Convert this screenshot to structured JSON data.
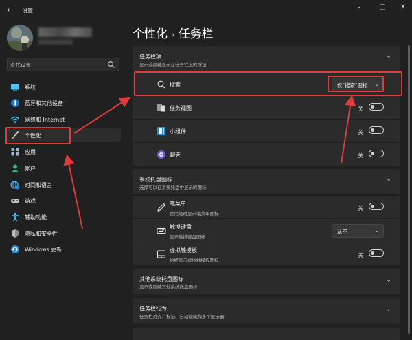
{
  "window": {
    "title": "设置",
    "back_icon": "back-arrow-icon",
    "controls": [
      "minimize-icon",
      "maximize-icon",
      "close-icon"
    ]
  },
  "sidebar": {
    "search": {
      "placeholder": "查找设置",
      "value": ""
    },
    "items": [
      {
        "label": "系统",
        "icon": "monitor-icon",
        "color": "#4cc2ff"
      },
      {
        "label": "蓝牙和其他设备",
        "icon": "bluetooth-icon",
        "color": "#4cc2ff"
      },
      {
        "label": "网络和 Internet",
        "icon": "wifi-icon",
        "color": "#4cc2ff"
      },
      {
        "label": "个性化",
        "icon": "brush-icon",
        "color": "#e8a96a",
        "active": true
      },
      {
        "label": "应用",
        "icon": "apps-icon",
        "color": "#9fb7c8"
      },
      {
        "label": "帐户",
        "icon": "person-icon",
        "color": "#3fb27f"
      },
      {
        "label": "时间和语言",
        "icon": "globe-clock-icon",
        "color": "#4cc2ff"
      },
      {
        "label": "游戏",
        "icon": "gamepad-icon",
        "color": "#bfbfbf"
      },
      {
        "label": "辅助功能",
        "icon": "accessibility-icon",
        "color": "#4cc2ff"
      },
      {
        "label": "隐私和安全性",
        "icon": "shield-icon",
        "color": "#9a9a9a"
      },
      {
        "label": "Windows 更新",
        "icon": "update-icon",
        "color": "#4cc2ff"
      }
    ]
  },
  "breadcrumb": {
    "parent": "个性化",
    "separator": "›",
    "current": "任务栏"
  },
  "sections": {
    "taskbar_items": {
      "title": "任务栏项",
      "subtitle": "显示或隐藏显示在任务栏上的按钮",
      "rows": [
        {
          "label": "搜索",
          "icon": "search-icon",
          "control": "dropdown",
          "value": "仅\"搜索\"图标"
        },
        {
          "label": "任务视图",
          "icon": "task-view-icon",
          "control": "toggle",
          "state": "关"
        },
        {
          "label": "小组件",
          "icon": "widgets-icon",
          "control": "toggle",
          "state": "关"
        },
        {
          "label": "聊天",
          "icon": "chat-icon",
          "control": "toggle",
          "state": "关"
        }
      ]
    },
    "tray_icons": {
      "title": "系统托盘图标",
      "subtitle": "选择可以在系统托盘中显示的图标",
      "rows": [
        {
          "label": "笔菜单",
          "sub": "使用笔时显示笔菜单图标",
          "icon": "pen-icon",
          "control": "toggle",
          "state": "关"
        },
        {
          "label": "触摸键盘",
          "sub": "显示触摸键盘图标",
          "icon": "keyboard-icon",
          "control": "dropdown",
          "value": "从不"
        },
        {
          "label": "虚拟触摸板",
          "sub": "始终显示虚拟触摸板图标",
          "icon": "touchpad-icon",
          "control": "toggle",
          "state": "关"
        }
      ]
    },
    "other_tray": {
      "title": "其他系统托盘图标",
      "subtitle": "显示或隐藏其他系统托盘图标"
    },
    "behaviors": {
      "title": "任务栏行为",
      "subtitle": "任务栏对齐、标记、自动隐藏和多个显示器"
    }
  },
  "colors": {
    "annotation_red": "#e23b3b",
    "background": "#202020",
    "card": "#2b2b2b"
  }
}
